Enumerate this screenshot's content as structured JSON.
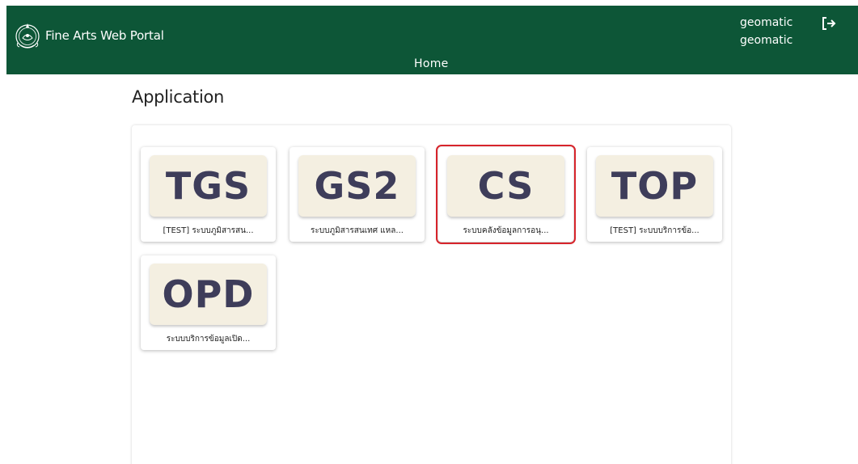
{
  "header": {
    "brand_title": "Fine Arts Web Portal",
    "logo_icon": "fine-arts-emblem-icon",
    "nav_home": "Home",
    "user_line1": "geomatic",
    "user_line2": "geomatic",
    "logout_icon": "logout-icon",
    "background_color": "#0d5637"
  },
  "main": {
    "heading": "Application",
    "apps": [
      {
        "code": "TGS",
        "name": "[TEST] ระบบภูมิสารสน...",
        "selected": false
      },
      {
        "code": "GS2",
        "name": "ระบบภูมิสารสนเทศ แหล...",
        "selected": false
      },
      {
        "code": "CS",
        "name": "ระบบคลังข้อมูลการอนุ...",
        "selected": true
      },
      {
        "code": "TOP",
        "name": "[TEST] ระบบบริการข้อ...",
        "selected": false
      },
      {
        "code": "OPD",
        "name": "ระบบบริการข้อมูลเปิด...",
        "selected": false
      }
    ],
    "tile_color": "#f4efe1",
    "code_color": "#3e3d5a",
    "selected_border_color": "#d7242b"
  }
}
